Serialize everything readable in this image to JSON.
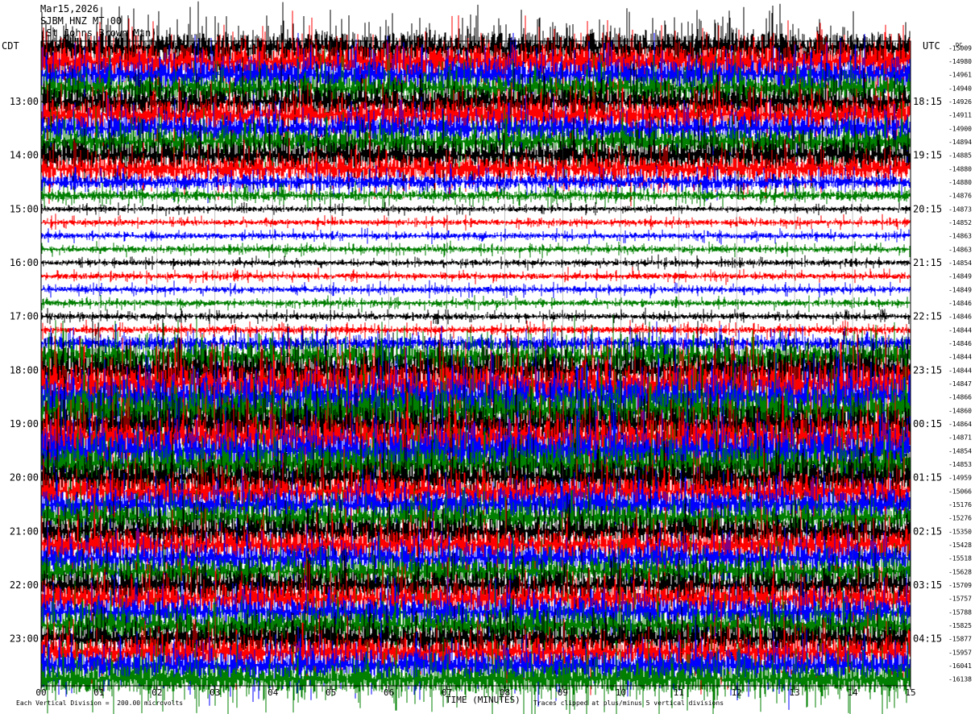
{
  "header": {
    "date": "Mar15,2026",
    "station": "SJBM HNZ MT 00",
    "location": "(St Johns Brown Mtn)"
  },
  "left_tz": "CDT",
  "right_tz": "UTC",
  "scale_unit": "DC",
  "footer": {
    "scale": "Each Vertical Division =  200.00 microvolts",
    "clip": "Traces clipped at plus/minus 5 vertical divisions"
  },
  "chart_data": {
    "type": "line",
    "title": "",
    "xlabel": "TIME (MINUTES)",
    "ylabel": "",
    "x_ticks": [
      "00",
      "01",
      "02",
      "03",
      "04",
      "05",
      "06",
      "07",
      "08",
      "09",
      "10",
      "11",
      "12",
      "13",
      "14",
      "15"
    ],
    "xlim": [
      0,
      15
    ],
    "left_hour_labels": [
      "13:00",
      "14:00",
      "15:00",
      "16:00",
      "17:00",
      "18:00",
      "19:00",
      "20:00",
      "21:00",
      "22:00",
      "23:00"
    ],
    "right_hour_labels": [
      "18:15",
      "19:15",
      "20:15",
      "21:15",
      "22:15",
      "23:15",
      "00:15",
      "01:15",
      "02:15",
      "03:15",
      "04:15"
    ],
    "trace_colors": [
      "#000000",
      "#ff0000",
      "#0000ff",
      "#007f00"
    ],
    "trace_count": 48,
    "trace_dc_offsets": [
      -15009,
      -14980,
      -14961,
      -14940,
      -14926,
      -14911,
      -14900,
      -14894,
      -14885,
      -14880,
      -14880,
      -14876,
      -14873,
      -14852,
      -14863,
      -14863,
      -14854,
      -14849,
      -14849,
      -14846,
      -14846,
      -14844,
      -14846,
      -14844,
      -14844,
      -14847,
      -14866,
      -14860,
      -14864,
      -14871,
      -14854,
      -14853,
      -14959,
      -15066,
      -15176,
      -15276,
      -15350,
      -15428,
      -15518,
      -15628,
      -15709,
      -15757,
      -15788,
      -15825,
      -15877,
      -15957,
      -16041,
      -16138
    ],
    "trace_activity": [
      3.4,
      3.4,
      3.0,
      2.6,
      3.0,
      3.0,
      2.6,
      2.6,
      3.0,
      2.4,
      1.4,
      1.0,
      0.5,
      0.55,
      0.6,
      0.6,
      0.55,
      0.6,
      0.6,
      0.6,
      0.6,
      0.7,
      1.4,
      2.8,
      3.6,
      4.2,
      4.2,
      4.2,
      3.8,
      4.2,
      4.2,
      3.6,
      3.6,
      3.0,
      3.0,
      2.8,
      3.0,
      3.0,
      2.8,
      2.6,
      3.0,
      3.0,
      2.8,
      3.0,
      3.0,
      3.0,
      3.0,
      3.0
    ]
  }
}
